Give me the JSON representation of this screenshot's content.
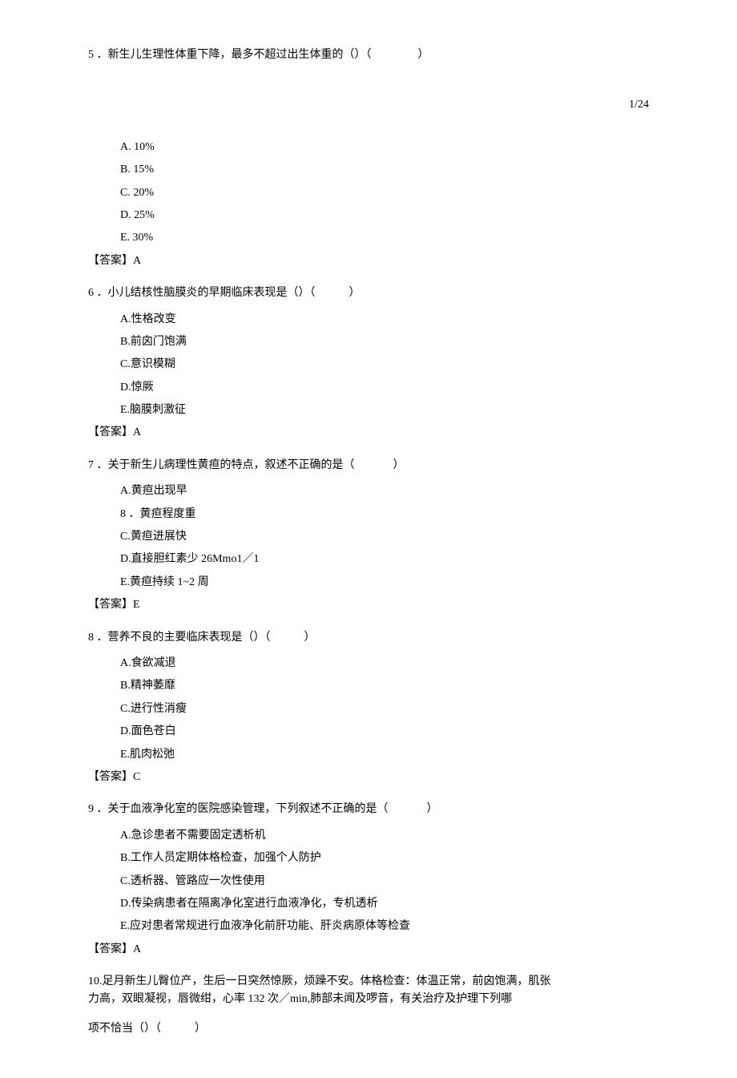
{
  "page_number": "1/24",
  "q5": {
    "stem_pre": "5  ．新生儿生理性体重下降，最多不超过出生体重的（）（",
    "stem_post": "）",
    "options": {
      "a": "A.  10%",
      "b": "B.  15%",
      "c": "C.  20%",
      "d": "D.  25%",
      "e": "E.  30%"
    },
    "answer": "【答案】A"
  },
  "q6": {
    "stem_pre": "6  ．小儿结核性脑膜炎的早期临床表现是（）（",
    "stem_post": "）",
    "options": {
      "a": "A.性格改变",
      "b": "B.前囟门饱满",
      "c": "C.意识模糊",
      "d": "D.惊厥",
      "e": "E.脑膜刺激征"
    },
    "answer": "【答案】A"
  },
  "q7": {
    "stem_pre": "7  ．关于新生儿病理性黄疸的特点，叙述不正确的是（",
    "stem_post": "）",
    "options": {
      "a": "A.黄疸出现早",
      "b": "8  ．黄疸程度重",
      "c": "C.黄疸进展快",
      "d": "D.直接胆红素少 26Mmo1／1",
      "e": "E.黄疸持续 1~2 周"
    },
    "answer": "【答案】E"
  },
  "q8": {
    "stem_pre": "8  ．营养不良的主要临床表现是（）（",
    "stem_post": "）",
    "options": {
      "a": "A.食欲减退",
      "b": "B.精神萎靡",
      "c": "C.进行性消瘦",
      "d": "D.面色苍白",
      "e": "E.肌肉松弛"
    },
    "answer": "【答案】C"
  },
  "q9": {
    "stem_pre": "9  ．关于血液净化室的医院感染管理，下列叙述不正确的是（",
    "stem_post": "）",
    "options": {
      "a": "A.急诊患者不需要固定透析机",
      "b": "B.工作人员定期体格检查，加强个人防护",
      "c": "C.透析器、管路应一次性使用",
      "d": "D.传染病患者在隔离净化室进行血液净化，专机透析",
      "e": "E.应对患者常规进行血液净化前肝功能、肝炎病原体等检查"
    },
    "answer": "【答案】A"
  },
  "q10": {
    "line1": "10.足月新生儿臀位产，生后一日突然惊厥，烦躁不安。体格检查：体温正常，前囟饱满，肌张",
    "line2": "力高，双眼凝视，唇微绀，心率 132 次／min,肺部未闻及啰音，有关治疗及护理下列哪",
    "line3_pre": "项不恰当（）（",
    "line3_post": "）"
  }
}
